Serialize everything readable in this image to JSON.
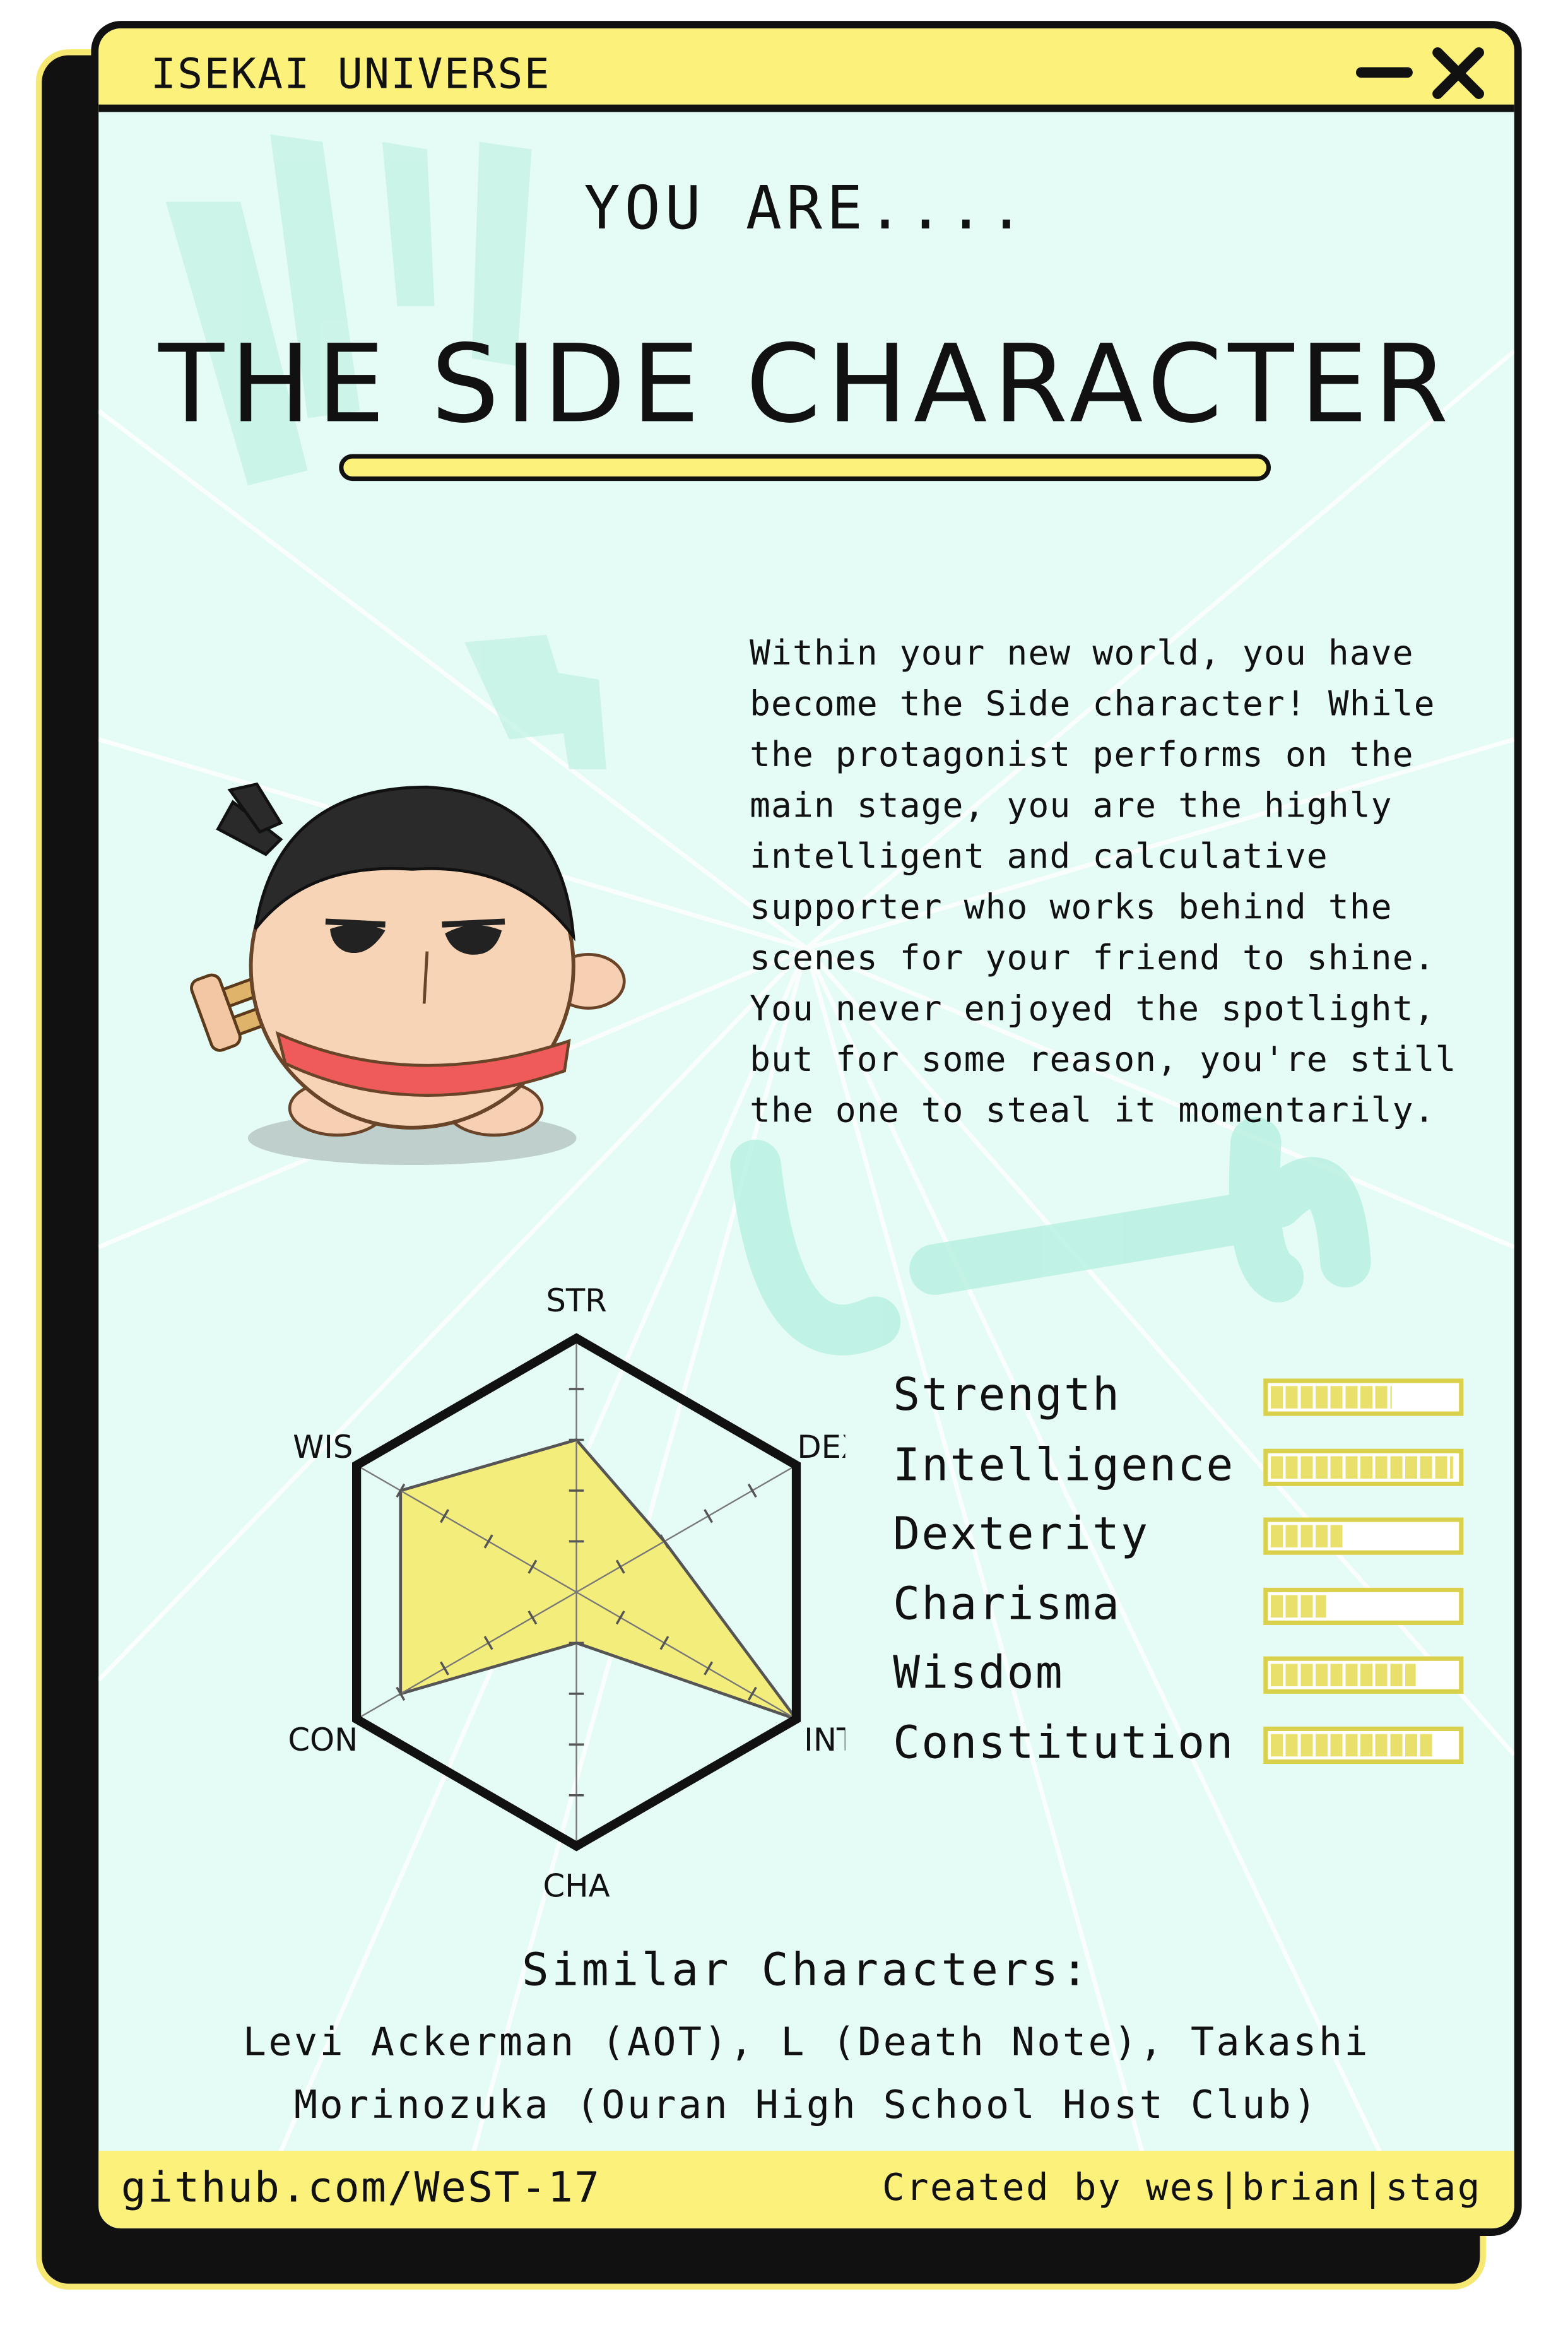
{
  "window": {
    "title": "ISEKAI UNIVERSE"
  },
  "heading": {
    "intro": "YOU ARE....",
    "result": "THE SIDE CHARACTER"
  },
  "description": "Within your new world, you have become the Side character! While the protagonist performs on the main stage, you are the highly intelligent and calculative supporter who works behind the scenes for your friend to shine. You never enjoyed the spotlight, but for some reason, you're still the one to steal it momentarily.",
  "chart_data": {
    "type": "radar",
    "axes": [
      "STR",
      "DEX",
      "INT",
      "CHA",
      "CON",
      "WIS"
    ],
    "max": 5,
    "values": [
      3,
      2,
      5,
      1,
      4,
      4
    ],
    "fill_color": "#f3ee7c",
    "outline_color": "#111111"
  },
  "stats": [
    {
      "label": "Strength",
      "level": 0.65
    },
    {
      "label": "Intelligence",
      "level": 0.98
    },
    {
      "label": "Dexterity",
      "level": 0.4
    },
    {
      "label": "Charisma",
      "level": 0.3
    },
    {
      "label": "Wisdom",
      "level": 0.78
    },
    {
      "label": "Constitution",
      "level": 0.88
    }
  ],
  "similar": {
    "title": "Similar Characters:",
    "list": "Levi Ackerman (AOT), L (Death Note), Takashi Morinozuka (Ouran High School Host Club)"
  },
  "footer": {
    "left": "github.com/WeST-17",
    "right": "Created by wes|brian|stag"
  },
  "icons": {
    "minimize": "minimize-icon",
    "close": "close-icon",
    "mascot": "ninja-mascot-illustration"
  },
  "colors": {
    "accent_yellow": "#fcf17a",
    "background_mint": "#e4fbf6",
    "outline": "#111111"
  }
}
